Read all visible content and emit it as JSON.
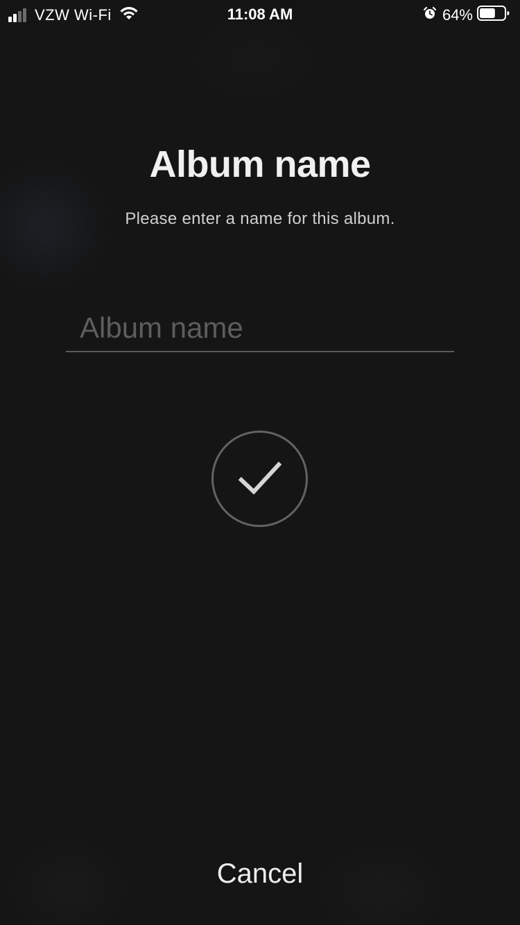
{
  "status_bar": {
    "carrier": "VZW Wi-Fi",
    "time": "11:08 AM",
    "battery_percent": "64%",
    "battery_level": 0.64,
    "signal_bars_active": 2,
    "signal_bars_total": 4,
    "icons": [
      "signal-icon",
      "wifi-icon",
      "alarm-icon",
      "battery-icon"
    ]
  },
  "dialog": {
    "title": "Album name",
    "subtitle": "Please enter a name for this album.",
    "input": {
      "value": "",
      "placeholder": "Album name"
    },
    "confirm_icon": "checkmark-icon",
    "cancel_label": "Cancel"
  },
  "colors": {
    "background": "#151515",
    "text": "#f0f0f0",
    "muted": "#5d5d5d",
    "ring": "#636363"
  }
}
